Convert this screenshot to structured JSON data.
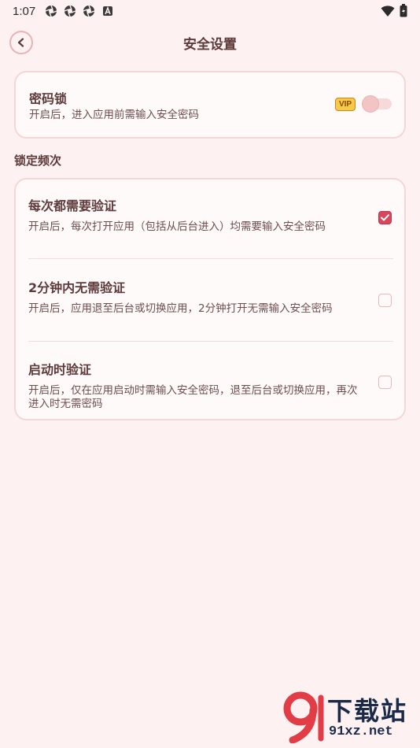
{
  "status_bar": {
    "time": "1:07",
    "notification_icons": [
      "aperture-icon",
      "aperture-icon",
      "aperture-icon",
      "a-badge-icon"
    ],
    "right_icons": [
      "wifi-icon",
      "battery-icon"
    ]
  },
  "header": {
    "title": "安全设置",
    "back_icon": "chevron-left-icon"
  },
  "password_lock": {
    "title": "密码锁",
    "description": "开启后，进入应用前需输入安全密码",
    "vip_badge": "VIP",
    "enabled": false
  },
  "frequency": {
    "section_label": "锁定频次",
    "options": [
      {
        "title": "每次都需要验证",
        "description": "开启后，每次打开应用（包括从后台进入）均需要输入安全密码",
        "checked": true
      },
      {
        "title": "2分钟内无需验证",
        "description": "开启后，应用退至后台或切换应用，2分钟打开无需输入安全密码",
        "checked": false
      },
      {
        "title": "启动时验证",
        "description": "开启后，仅在应用启动时需输入安全密码，退至后台或切换应用，再次进入时无需密码",
        "checked": false
      }
    ]
  },
  "watermark": {
    "brand": "下载站",
    "domain": "91xz.net"
  },
  "colors": {
    "background": "#fdf1f1",
    "accent": "#d9455a",
    "text": "#5e3a3a",
    "vip": "#f7c948"
  }
}
